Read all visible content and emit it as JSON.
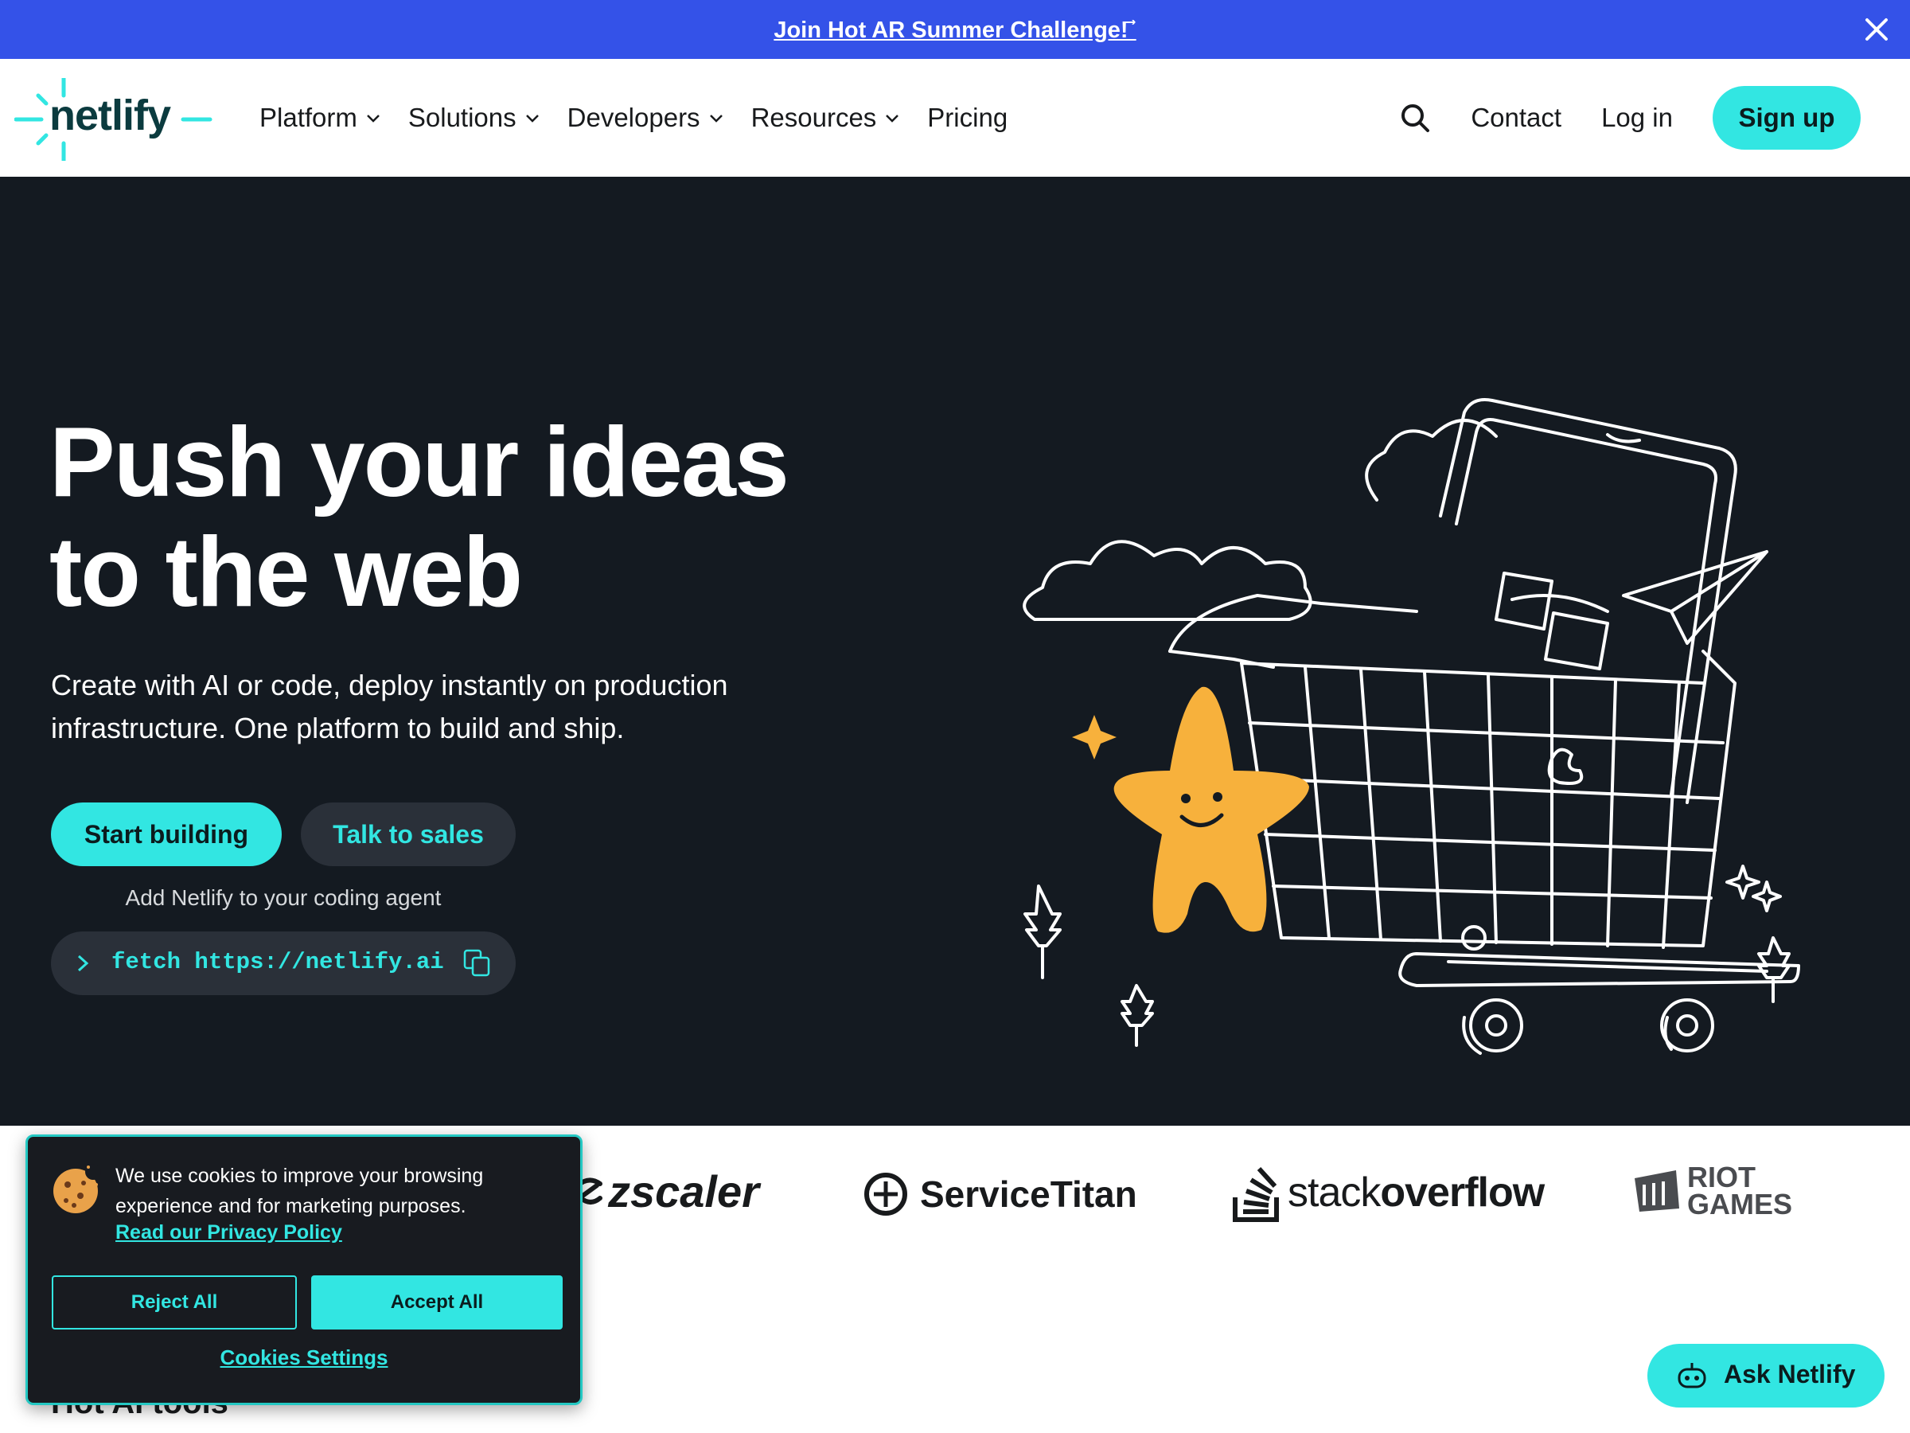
{
  "announcement": {
    "text": "Join Hot AR Summer Challenge! ⃗",
    "close_icon": "close-icon"
  },
  "header": {
    "logo_text": "netlify",
    "nav": [
      {
        "label": "Platform",
        "has_dropdown": true
      },
      {
        "label": "Solutions",
        "has_dropdown": true
      },
      {
        "label": "Developers",
        "has_dropdown": true
      },
      {
        "label": "Resources",
        "has_dropdown": true
      },
      {
        "label": "Pricing",
        "has_dropdown": false
      }
    ],
    "contact": "Contact",
    "login": "Log in",
    "signup": "Sign up"
  },
  "hero": {
    "title_line1": "Push your ideas",
    "title_line2": "to the web",
    "subtitle": "Create with AI or code, deploy instantly on production infrastructure. One platform to build and ship.",
    "primary_cta": "Start building",
    "secondary_cta": "Talk to sales",
    "agent_label": "Add Netlify to your coding agent",
    "command": "fetch https://netlify.ai"
  },
  "logos": {
    "zscaler": "zscaler",
    "servicetitan": "ServiceTitan",
    "stack_light": "stack",
    "stack_bold": "overflow",
    "riot_line1": "RIOT",
    "riot_line2": "GAMES"
  },
  "peek_text": "Hot AI tools",
  "cookie": {
    "message": "We use cookies to improve your browsing experience and for marketing purposes.",
    "privacy_link": "Read our Privacy Policy",
    "reject": "Reject All",
    "accept": "Accept All",
    "settings": "Cookies Settings"
  },
  "ask": {
    "label": "Ask Netlify"
  },
  "colors": {
    "banner": "#3452e8",
    "accent": "#32e6e2",
    "hero_bg": "#141a21",
    "star": "#f7b13c"
  }
}
